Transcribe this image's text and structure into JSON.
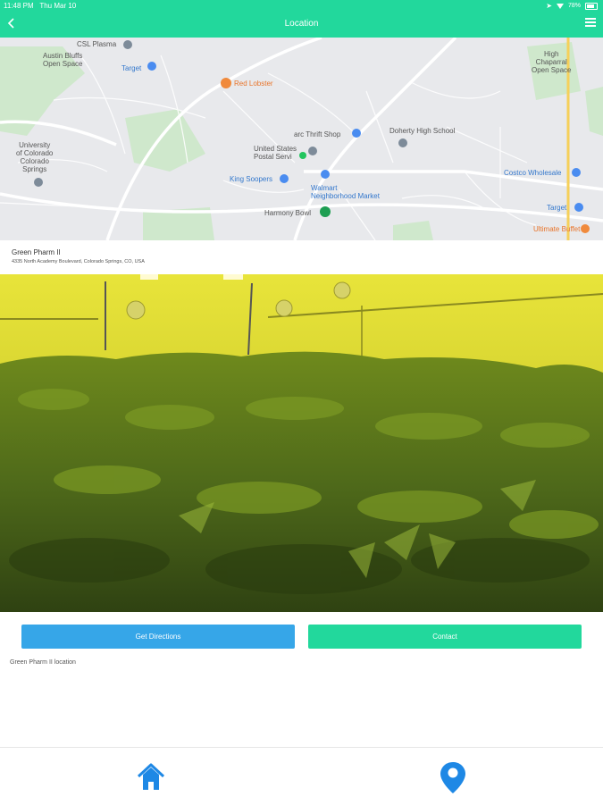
{
  "status_bar": {
    "time": "11:48 PM",
    "date": "Thu Mar 10",
    "battery": "78%"
  },
  "app_bar": {
    "title": "Location"
  },
  "map": {
    "labels": {
      "csl_plasma": "CSL Plasma",
      "austin_bluffs": "Austin Bluffs\nOpen Space",
      "target_1": "Target",
      "red_lobster": "Red Lobster",
      "high_chaparral": "High\nChaparral\nOpen Space",
      "university": "University\nof Colorado\nColorado\nSprings",
      "arc_thrift": "arc Thrift Shop",
      "doherty": "Doherty High School",
      "usps": "United States\nPostal Servi",
      "king_soopers": "King Soopers",
      "walmart": "Walmart\nNeighborhood Market",
      "costco": "Costco Wholesale",
      "harmony_bowl": "Harmony Bowl",
      "target_2": "Target",
      "ultimate_buffet": "Ultimate Buffet"
    }
  },
  "location": {
    "name": "Green Pharm II",
    "address": "4335 North Academy Boulevard, Colorado Springs, CO, USA"
  },
  "actions": {
    "directions_label": "Get Directions",
    "contact_label": "Contact"
  },
  "caption": "Green Pharm II location",
  "nav": {
    "icons": [
      "home-icon",
      "map-pin-icon"
    ]
  },
  "colors": {
    "primary": "#22d89c",
    "directions": "#36a6e8",
    "nav_icon": "#1e88e5"
  }
}
